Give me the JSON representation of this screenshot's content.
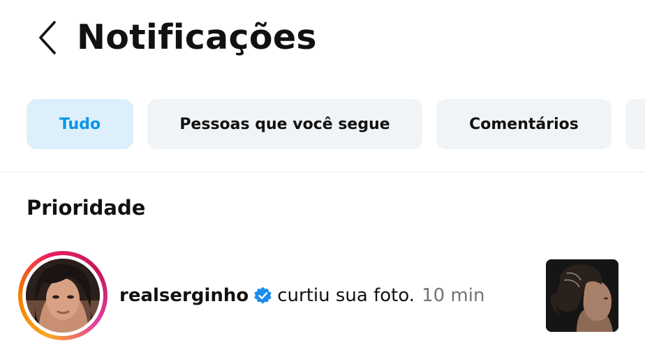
{
  "header": {
    "title": "Notificações",
    "back_icon": "chevron-left-icon"
  },
  "filters": {
    "chips": [
      {
        "label": "Tudo",
        "active": true
      },
      {
        "label": "Pessoas que você segue",
        "active": false
      },
      {
        "label": "Comentários",
        "active": false
      },
      {
        "label": "",
        "active": false
      }
    ]
  },
  "section": {
    "title": "Prioridade"
  },
  "notification": {
    "username": "realserginho",
    "verified_icon": "verified-badge-icon",
    "action": "curtiu sua foto.",
    "time": "10 min"
  },
  "colors": {
    "accent": "#0a95e8",
    "active_chip_bg": "#ddeffb",
    "chip_bg": "#f1f4f7",
    "verified": "#1a8cf0",
    "muted_text": "#737373"
  }
}
